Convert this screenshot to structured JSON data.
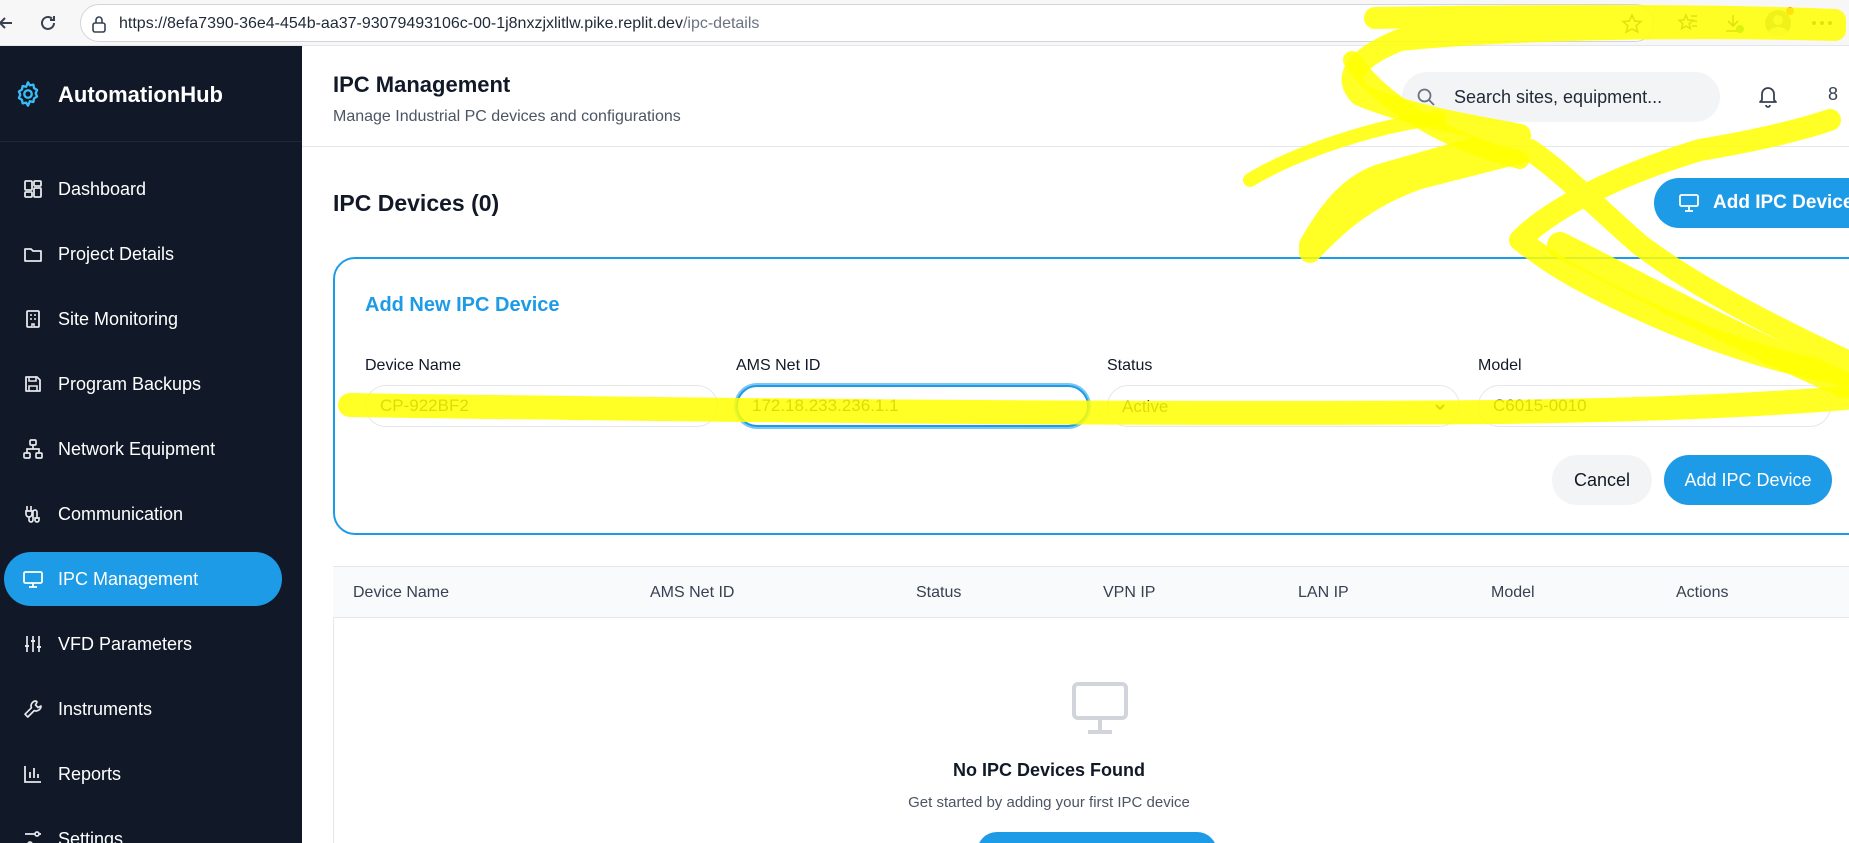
{
  "browser": {
    "url_host": "https://8efa7390-36e4-454b-aa37-93079493106c-00-1j8nxzjxlitlw.pike.replit.dev",
    "url_path": "/ipc-details"
  },
  "sidebar": {
    "brand": "AutomationHub",
    "items": [
      {
        "label": "Dashboard",
        "icon": "dashboard-icon"
      },
      {
        "label": "Project Details",
        "icon": "folder-icon"
      },
      {
        "label": "Site Monitoring",
        "icon": "building-icon"
      },
      {
        "label": "Program Backups",
        "icon": "save-icon"
      },
      {
        "label": "Network Equipment",
        "icon": "network-icon"
      },
      {
        "label": "Communication",
        "icon": "cable-icon"
      },
      {
        "label": "IPC Management",
        "icon": "monitor-icon",
        "active": true
      },
      {
        "label": "VFD Parameters",
        "icon": "sliders-icon"
      },
      {
        "label": "Instruments",
        "icon": "wrench-icon"
      },
      {
        "label": "Reports",
        "icon": "bar-chart-icon"
      },
      {
        "label": "Settings",
        "icon": "settings-icon"
      }
    ]
  },
  "header": {
    "title": "IPC Management",
    "subtitle": "Manage Industrial PC devices and configurations",
    "search_placeholder": "Search sites, equipment...",
    "extra": "8"
  },
  "main": {
    "section_title": "IPC Devices (0)",
    "add_button": "Add IPC Device"
  },
  "form": {
    "title": "Add New IPC Device",
    "fields": {
      "device_name": {
        "label": "Device Name",
        "value": "CP-922BF2"
      },
      "ams_net_id": {
        "label": "AMS Net ID",
        "value": "172.18.233.236.1.1"
      },
      "status": {
        "label": "Status",
        "value": "Active"
      },
      "model": {
        "label": "Model",
        "value": "C6015-0010"
      }
    },
    "cancel": "Cancel",
    "submit": "Add IPC Device"
  },
  "table": {
    "columns": [
      "Device Name",
      "AMS Net ID",
      "Status",
      "VPN IP",
      "LAN IP",
      "Model",
      "Actions"
    ],
    "empty_title": "No IPC Devices Found",
    "empty_description": "Get started by adding your first IPC device"
  },
  "colors": {
    "accent": "#1d9be6",
    "sidebar_bg": "#111827",
    "highlighter": "#ffff00"
  }
}
